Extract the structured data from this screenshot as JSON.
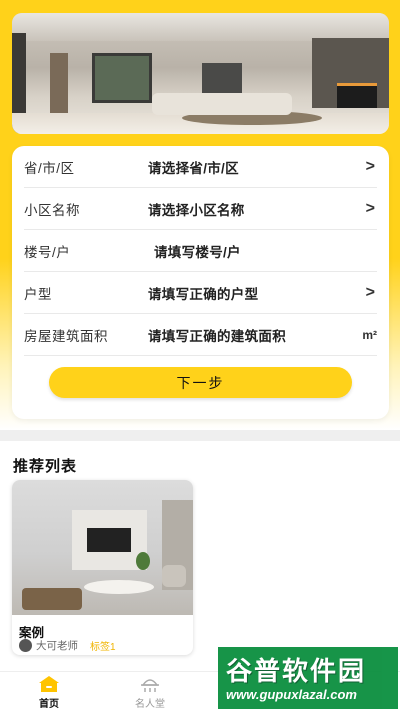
{
  "form": {
    "rows": [
      {
        "label": "省/市/区",
        "value": "请选择省/市/区",
        "arrow": ">"
      },
      {
        "label": "小区名称",
        "value": "请选择小区名称",
        "arrow": ">"
      },
      {
        "label": "楼号/户",
        "value": "请填写楼号/户"
      },
      {
        "label": "户型",
        "value": "请填写正确的户型",
        "arrow": ">"
      },
      {
        "label": "房屋建筑面积",
        "value": "请填写正确的建筑面积",
        "unit": "m²"
      }
    ],
    "next_label": "下一步"
  },
  "recommend": {
    "title": "推荐列表",
    "cases": [
      {
        "name": "案例",
        "author": "大可老师",
        "tag": "标签1"
      }
    ]
  },
  "tabbar": {
    "home_label": "首页",
    "celebrity_label": "名人堂"
  },
  "watermark": {
    "text": "谷普软件园",
    "url": "www.gupuxlazal.com"
  },
  "colors": {
    "accent": "#ffd21a",
    "watermark_bg": "#0b8f3f"
  }
}
